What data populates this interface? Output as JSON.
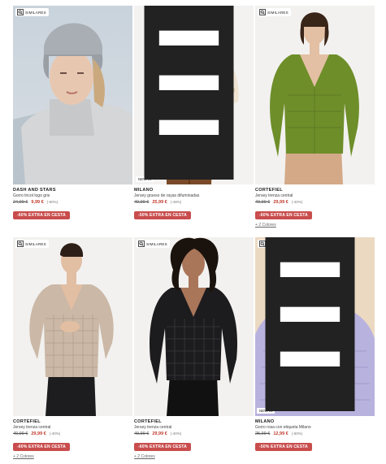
{
  "products": [
    {
      "has_similares": true,
      "similares_label": "SIMILARES",
      "brand": "DASH AND STARS",
      "name": "Gorro tricot logo gris",
      "old_price": "24,99 €",
      "new_price": "9,99 €",
      "discount": "(-60%)",
      "promo": "-60% EXTRA EN CESTA",
      "colors": "",
      "new_badge": "",
      "has_tag": false
    },
    {
      "has_similares": false,
      "similares_label": "",
      "brand": "MILANO",
      "name": "Jersey grueso de rayas difuminadas",
      "old_price": "49,99 €",
      "new_price": "25,99 €",
      "discount": "(-48%)",
      "promo": "-50% EXTRA EN CESTA",
      "colors": "",
      "new_badge": "NEW IN",
      "has_tag": true
    },
    {
      "has_similares": true,
      "similares_label": "SIMILARES",
      "brand": "CORTEFIEL",
      "name": "Jersey trenza central",
      "old_price": "49,99 €",
      "new_price": "29,99 €",
      "discount": "(-40%)",
      "promo": "-60% EXTRA EN CESTA",
      "colors": "+ 2 Colores",
      "new_badge": "",
      "has_tag": false
    },
    {
      "has_similares": true,
      "similares_label": "SIMILARES",
      "brand": "CORTEFIEL",
      "name": "Jersey trenza central",
      "old_price": "49,99 €",
      "new_price": "29,99 €",
      "discount": "(-40%)",
      "promo": "-60% EXTRA EN CESTA",
      "colors": "+ 2 Colores",
      "new_badge": "",
      "has_tag": false
    },
    {
      "has_similares": true,
      "similares_label": "SIMILARES",
      "brand": "CORTEFIEL",
      "name": "Jersey trenza central",
      "old_price": "49,99 €",
      "new_price": "29,99 €",
      "discount": "(-40%)",
      "promo": "-60% EXTRA EN CESTA",
      "colors": "+ 2 Colores",
      "new_badge": "",
      "has_tag": false
    },
    {
      "has_similares": true,
      "similares_label": "SIMILARES",
      "brand": "MILANO",
      "name": "Gorro rosa con etiqueta Milano",
      "old_price": "25,99 €",
      "new_price": "12,99 €",
      "discount": "(-50%)",
      "promo": "-50% EXTRA EN CESTA",
      "colors": "",
      "new_badge": "NEW IN",
      "has_tag": true
    }
  ],
  "colors": {
    "promo_bg": "#c94d4d",
    "sale_price": "#c0392b"
  }
}
